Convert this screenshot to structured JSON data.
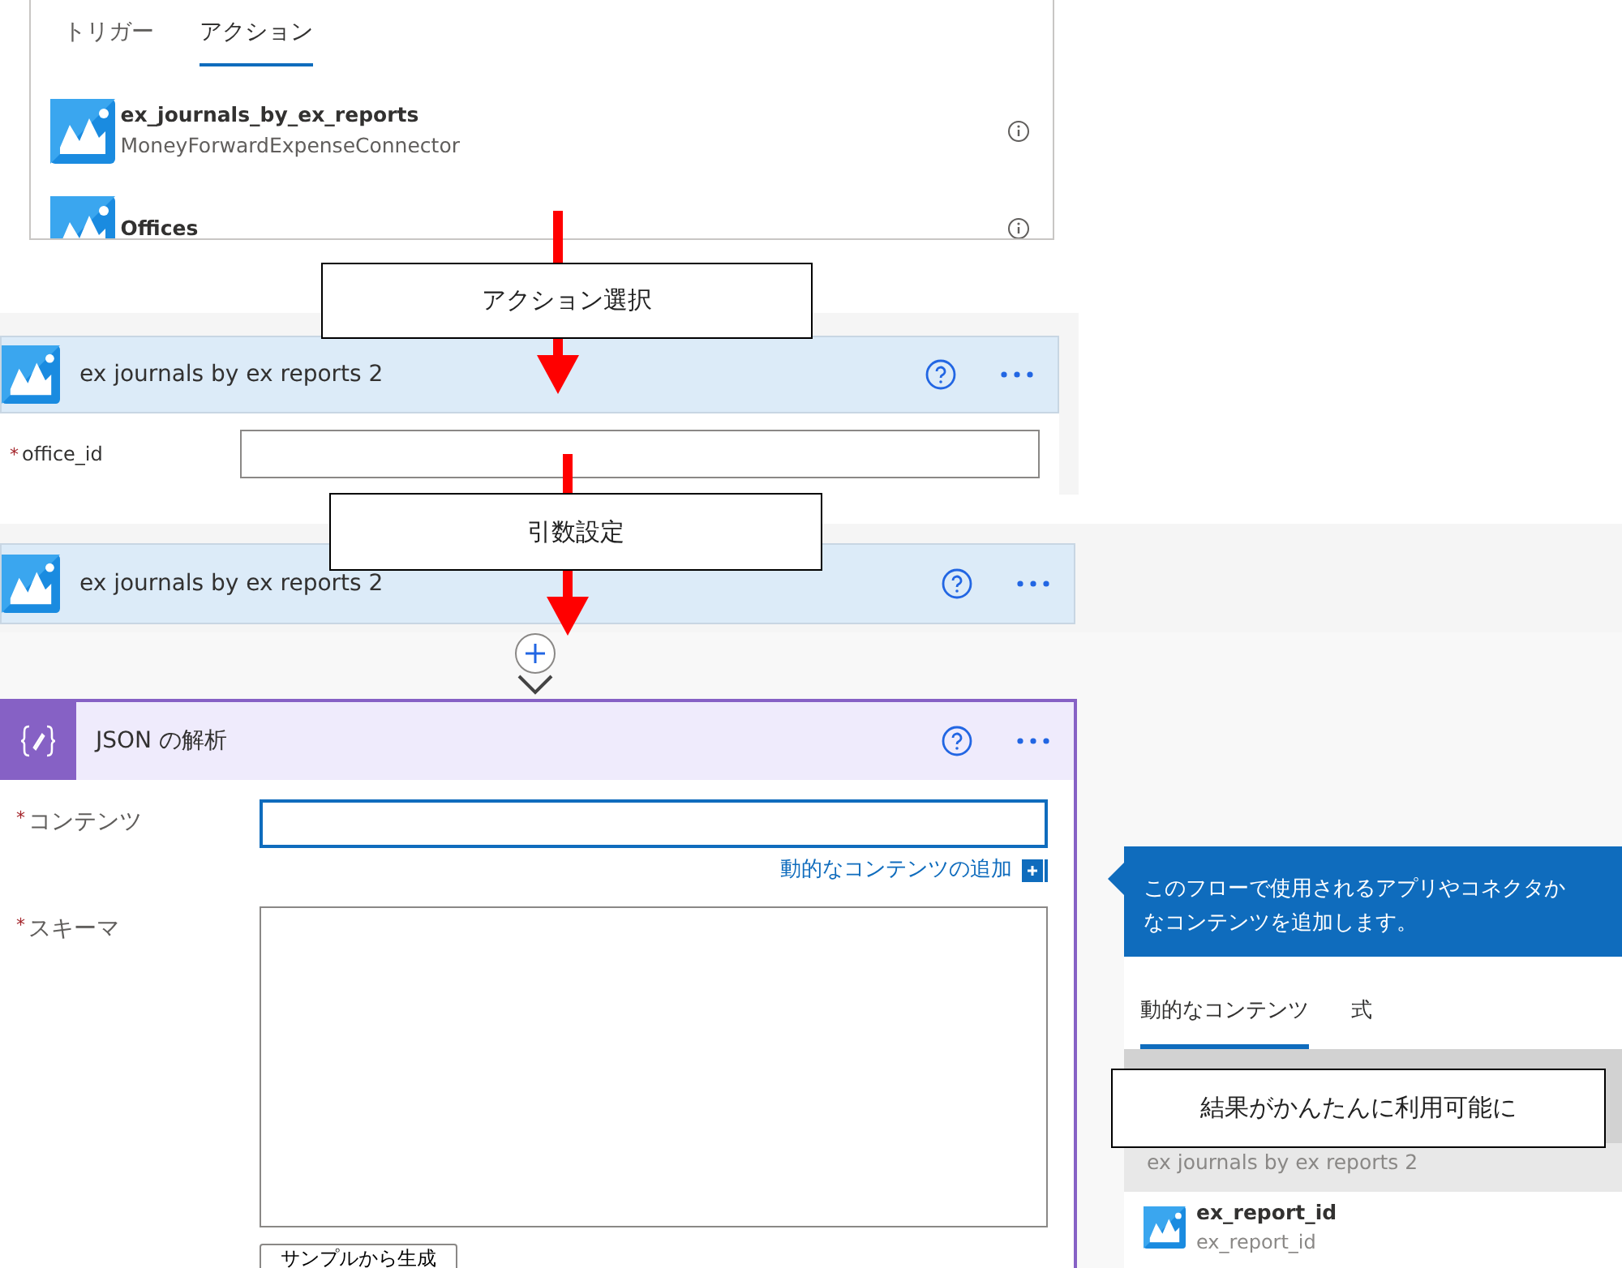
{
  "action_picker": {
    "tabs": [
      {
        "label": "トリガー",
        "selected": false
      },
      {
        "label": "アクション",
        "selected": true
      }
    ],
    "actions": [
      {
        "title": "ex_journals_by_ex_reports",
        "subtitle": "MoneyForwardExpenseConnector"
      },
      {
        "title": "Offices"
      }
    ]
  },
  "action_card": {
    "title": "ex journals by ex reports 2",
    "fields": [
      {
        "marker": "*",
        "label": "office_id"
      }
    ]
  },
  "collapsed_card": {
    "title": "ex journals by ex reports 2"
  },
  "parse_json_card": {
    "title": "JSON の解析",
    "fields": [
      {
        "marker": "*",
        "label": "コンテンツ",
        "kind": "input",
        "focused": true
      },
      {
        "marker": "*",
        "label": "スキーマ",
        "kind": "textarea",
        "focused": false
      }
    ],
    "add_dynamic_link": "動的なコンテンツの追加",
    "sample_button": "サンプルから生成"
  },
  "dynamic_content_panel": {
    "description_lines": [
      "このフローで使用されるアプリやコネクタか",
      "なコンテンツを追加します。"
    ],
    "tabs": [
      {
        "label": "動的なコンテンツ",
        "selected": true
      },
      {
        "label": "式",
        "selected": false
      }
    ],
    "section": "ex journals by ex reports 2",
    "items": [
      {
        "title": "ex_report_id",
        "subtitle": "ex_report_id"
      }
    ]
  },
  "annotations": [
    {
      "text": "アクション選択"
    },
    {
      "text": "引数設定"
    },
    {
      "text": "結果がかんたんに利用可能に"
    }
  ]
}
